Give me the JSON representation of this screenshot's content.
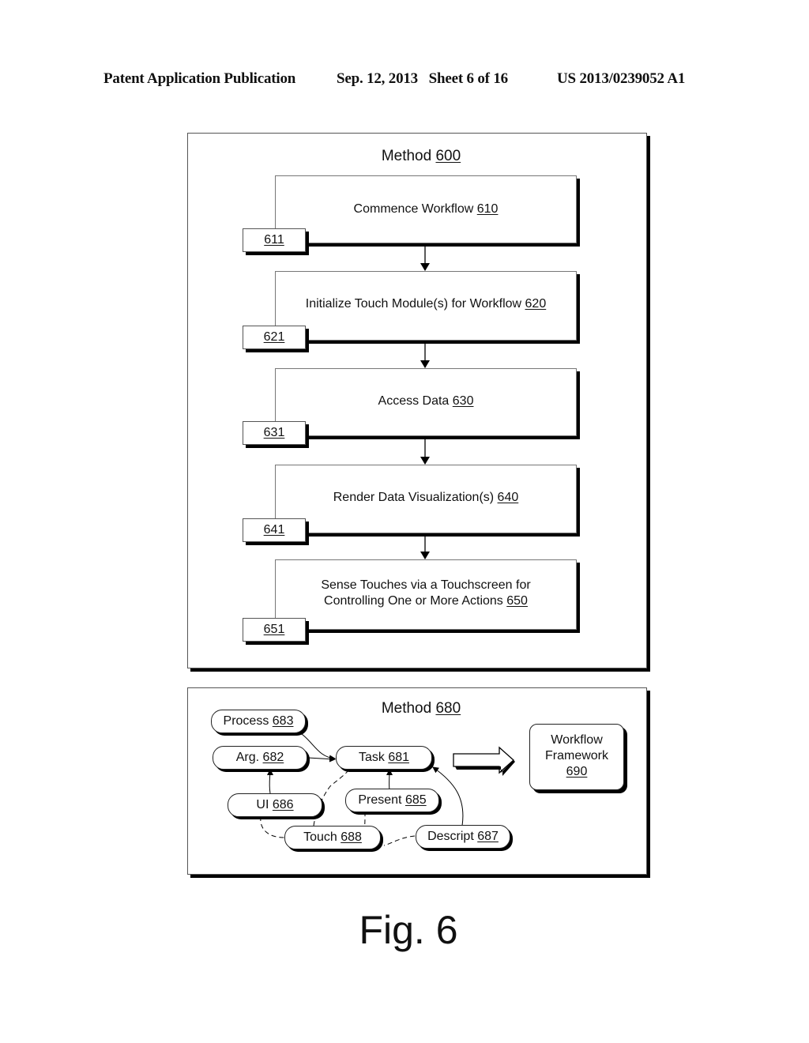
{
  "header": {
    "publication": "Patent Application Publication",
    "date_sheet": "Sep. 12, 2013   Sheet 6 of 16",
    "patent_number": "US 2013/0239052 A1"
  },
  "method600": {
    "title": "Method ",
    "ref": "600",
    "steps": [
      {
        "text": "Commence Workflow ",
        "ref": "610",
        "tab": "611"
      },
      {
        "text": "Initialize Touch Module(s) for Workflow ",
        "ref": "620",
        "tab": "621"
      },
      {
        "text": "Access Data ",
        "ref": "630",
        "tab": "631"
      },
      {
        "text": "Render Data Visualization(s) ",
        "ref": "640",
        "tab": "641"
      },
      {
        "text_line1": "Sense Touches via a Touchscreen for",
        "text": "Controlling One or More Actions ",
        "ref": "650",
        "tab": "651"
      }
    ]
  },
  "method680": {
    "title": "Method ",
    "ref": "680",
    "nodes": {
      "process": {
        "label": "Process ",
        "ref": "683"
      },
      "arg": {
        "label": "Arg. ",
        "ref": "682"
      },
      "task": {
        "label": "Task ",
        "ref": "681"
      },
      "ui": {
        "label": "UI ",
        "ref": "686"
      },
      "present": {
        "label": "Present ",
        "ref": "685"
      },
      "touch": {
        "label": "Touch ",
        "ref": "688"
      },
      "descript": {
        "label": "Descript ",
        "ref": "687"
      }
    },
    "framework": {
      "line1": "Workflow",
      "line2": "Framework",
      "ref": "690"
    }
  },
  "figure_label": "Fig. 6"
}
